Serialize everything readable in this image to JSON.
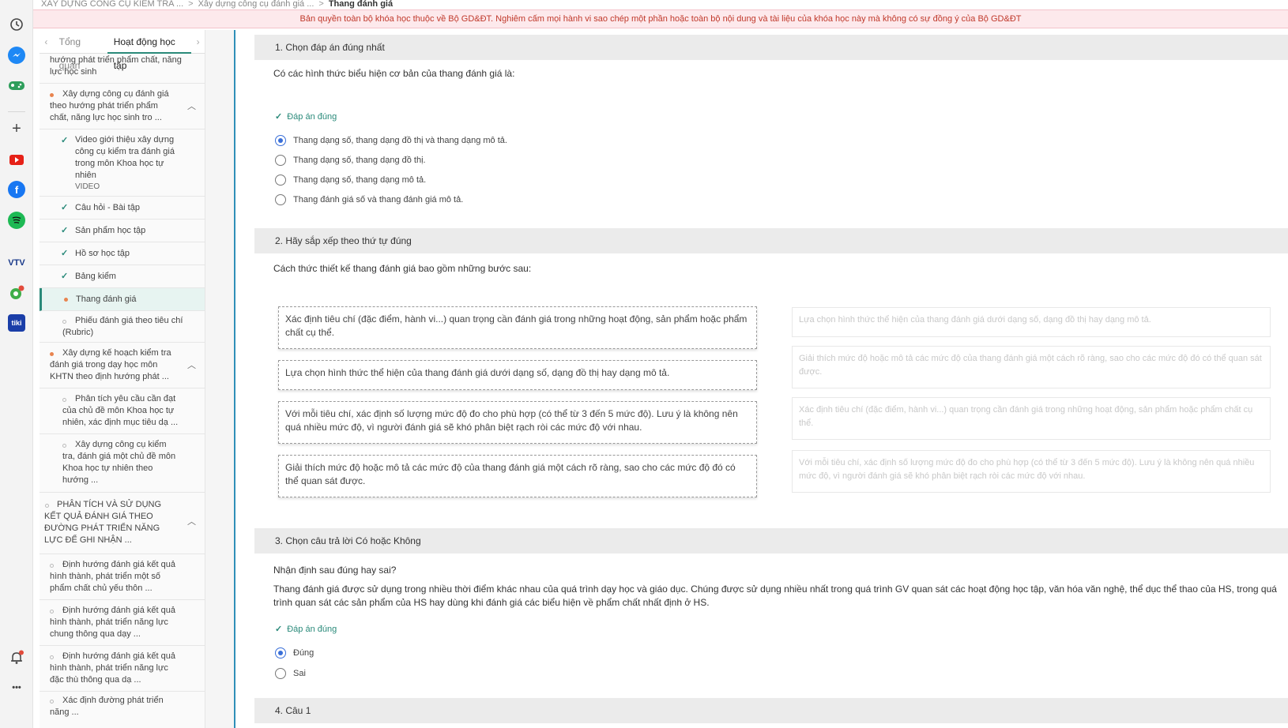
{
  "breadcrumb": {
    "items": [
      "XÂY DỰNG CÔNG CỤ KIỂM TRA ...",
      "Xây dựng công cụ đánh giá ...",
      "Thang đánh giá"
    ],
    "separator": ">"
  },
  "banner": {
    "text": "Bản quyền toàn bộ khóa học thuộc về Bộ GD&ĐT. Nghiêm cấm mọi hành vi sao chép một phần hoặc toàn bộ nội dung và tài liệu của khóa học này mà không có sự đồng ý của Bộ GD&ĐT"
  },
  "rail": {
    "icons": [
      "history-icon",
      "messenger-icon",
      "game-icon",
      "add-icon",
      "youtube-icon",
      "facebook-icon",
      "spotify-icon",
      "vtv-icon",
      "map-icon",
      "tiki-icon",
      "bell-icon",
      "more-icon"
    ],
    "vtv_label": "VTV",
    "tiki_label": "tiki",
    "more_label": "•••"
  },
  "sidenav": {
    "tabs": [
      "Tổng quan",
      "Hoạt động học tập"
    ],
    "items": [
      {
        "text": "hướng phát triển phẩm chất, năng lực học sinh"
      },
      {
        "text": "Xây dựng công cụ đánh giá theo hướng phát triển phẩm chất, năng lực học sinh tro ..."
      },
      {
        "text": "Video giới thiệu xây dựng công cụ kiểm tra đánh giá trong môn Khoa học tự nhiên",
        "sub": "VIDEO"
      },
      {
        "text": "Câu hỏi - Bài tập"
      },
      {
        "text": "Sản phẩm học tập"
      },
      {
        "text": "Hồ sơ học tập"
      },
      {
        "text": "Bảng kiểm"
      },
      {
        "text": "Thang đánh giá"
      },
      {
        "text": "Phiếu đánh giá theo tiêu chí (Rubric)"
      },
      {
        "text": "Xây dựng kế hoạch kiểm tra đánh giá trong dạy học môn KHTN theo định hướng phát ..."
      },
      {
        "text": "Phân tích yêu cầu cần đạt của chủ đề môn Khoa học tự nhiên, xác định mục tiêu dạ ..."
      },
      {
        "text": "Xây dựng công cụ kiểm tra, đánh giá một chủ đề môn Khoa học tự nhiên theo hướng ..."
      },
      {
        "text": "PHÂN TÍCH VÀ SỬ DỤNG KẾT QUẢ ĐÁNH GIÁ THEO ĐƯỜNG PHÁT TRIỂN NĂNG LỰC ĐỂ GHI NHẬN ..."
      },
      {
        "text": "Định hướng đánh giá kết quả hình thành, phát triển một số phẩm chất chủ yếu thôn ..."
      },
      {
        "text": "Định hướng đánh giá kết quả hình thành, phát triển năng lực chung thông qua dạy ..."
      },
      {
        "text": "Định hướng đánh giá kết quả hình thành, phát triển năng lực đặc thù thông qua dạ ..."
      },
      {
        "text": "Xác định đường phát triển năng ..."
      }
    ]
  },
  "questions": {
    "q1": {
      "header": "1. Chọn đáp án đúng nhất",
      "prompt": "Có các hình thức biểu hiện cơ bản của thang đánh giá là:",
      "correct_label": "Đáp án đúng",
      "options": [
        "Thang dạng số, thang dạng đồ thị và thang dạng mô tả.",
        "Thang dạng số, thang dạng đồ thị.",
        "Thang dạng số, thang dạng mô tả.",
        "Thang đánh giá số và thang đánh giá mô tả."
      ],
      "selected_index": 0
    },
    "q2": {
      "header": "2. Hãy sắp xếp theo thứ tự đúng",
      "prompt": "Cách thức thiết kế thang đánh giá bao gồm những bước sau:",
      "items": [
        "Xác định tiêu chí (đặc điểm, hành vi...) quan trọng cần đánh giá trong những hoạt động, sản phẩm hoặc phẩm chất cụ thể.",
        "Lựa chọn hình thức thể hiện của thang đánh giá dưới dạng số, dạng đồ thị hay dạng mô tả.",
        "Với mỗi tiêu chí, xác định số lượng mức độ đo cho phù hợp (có thể từ 3 đến 5 mức độ). Lưu ý là không nên quá nhiều mức độ, vì người đánh giá sẽ khó phân biệt rạch ròi các mức độ với nhau.",
        "Giải thích mức độ hoặc mô tả các mức độ của thang đánh giá một cách rõ ràng, sao cho các mức độ đó có thể quan sát được."
      ],
      "targets": [
        "Lựa chọn hình thức thể hiện của thang đánh giá dưới dạng số, dạng đồ thị hay dạng mô tả.",
        "Giải thích mức độ hoặc mô tả các mức độ của thang đánh giá một cách rõ ràng, sao cho các mức độ đó có thể quan sát được.",
        "Xác định tiêu chí (đặc điểm, hành vi...) quan trọng cần đánh giá trong những hoạt động, sản phẩm hoặc phẩm chất cụ thể.",
        "Với mỗi tiêu chí, xác định số lượng mức độ đo cho phù hợp (có thể từ 3 đến 5 mức độ). Lưu ý là không nên quá nhiều mức độ, vì người đánh giá sẽ khó phân biệt rạch ròi các mức độ với nhau."
      ]
    },
    "q3": {
      "header": "3. Chọn câu trả lời Có hoặc Không",
      "prompt": "Nhận định sau đúng hay sai?",
      "statement": "Thang đánh giá được sử dụng trong nhiều thời điểm khác nhau của quá trình dạy học và giáo dục. Chúng được sử dụng nhiều nhất trong quá trình GV quan sát các hoạt động học tập, văn hóa văn nghệ, thể dục thể thao của HS, trong quá trình quan sát các sản phẩm của HS hay dùng khi đánh giá các biểu hiện về phẩm chất nhất định ở HS.",
      "correct_label": "Đáp án đúng",
      "options": [
        "Đúng",
        "Sai"
      ],
      "selected_index": 0
    },
    "q4": {
      "header": "4. Câu 1"
    }
  },
  "colors": {
    "accent": "#2a8a7a",
    "radio": "#3a6fd8",
    "banner_text": "#c0392b",
    "banner_bg": "#fde9ec"
  }
}
